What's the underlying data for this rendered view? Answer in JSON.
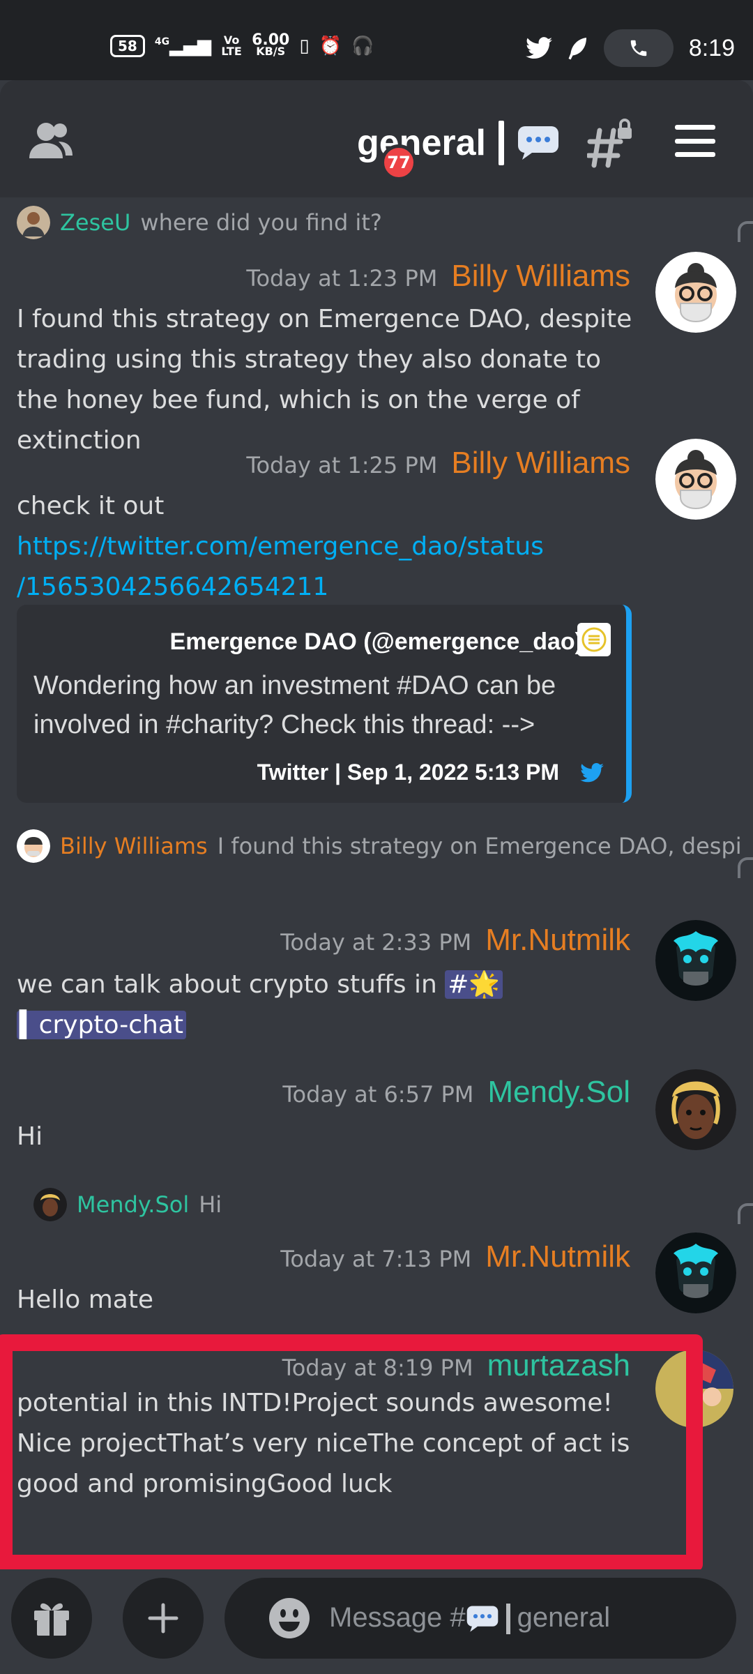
{
  "status_bar": {
    "battery": "58",
    "network_type": "4G",
    "volte": "Vo LTE",
    "speed_value": "6.00",
    "speed_unit": "KB/S",
    "time": "8:19",
    "icons": [
      "twitter-icon",
      "feather-icon",
      "phone-icon",
      "vibrate-icon",
      "alarm-icon",
      "headset-icon"
    ]
  },
  "header": {
    "channel_name": "general",
    "unread_badge": "77",
    "icons": [
      "members-icon",
      "speech-bubble-icon",
      "locked-thread-icon",
      "hamburger-menu-icon"
    ]
  },
  "messages": [
    {
      "reply_to": {
        "author": "ZeseU",
        "text": "where did you find it?"
      },
      "timestamp": "Today at 1:23 PM",
      "author": "Billy Williams",
      "text": "I found this strategy on Emergence DAO, despite trading using this strategy they also donate to the honey bee fund, which is on the verge of extinction"
    },
    {
      "timestamp": "Today at 1:25 PM",
      "author": "Billy Williams",
      "text": "check it out",
      "link": "https://twitter.com/emergence_dao/status/1565304256642654211",
      "link_line1": "https://twitter.com/emergence_dao/status",
      "link_line2": "/1565304256642654211",
      "embed": {
        "author": "Emergence DAO (@emergence_dao)",
        "text": "Wondering how an investment #DAO can be involved in #charity? Check this thread: -->",
        "footer": "Twitter | Sep 1, 2022 5:13 PM"
      }
    },
    {
      "reply_to": {
        "author": "Billy Williams",
        "text": "I found this strategy on Emergence DAO, despite trading using this strategy they also donate to the honey bee fund,"
      },
      "timestamp": "Today at 2:33 PM",
      "author": "Mr.Nutmilk",
      "text": "we can talk about crypto stuffs in ",
      "channel_mention_prefix": "#",
      "channel_mention_emoji": "🌟",
      "channel_mention_name": "▍crypto-chat"
    },
    {
      "timestamp": "Today at 6:57 PM",
      "author": "Mendy.Sol",
      "text": "Hi"
    },
    {
      "reply_to": {
        "author": "Mendy.Sol",
        "text": "Hi"
      },
      "timestamp": "Today at 7:13 PM",
      "author": "Mr.Nutmilk",
      "text": "Hello mate"
    },
    {
      "timestamp": "Today at 8:19 PM",
      "author": "murtazash",
      "text": "potential in this INTD!Project sounds awesome! Nice projectThat’s very niceThe concept of act is good and promisingGood luck"
    }
  ],
  "composer": {
    "placeholder_prefix": "Message #",
    "placeholder_channel": "general",
    "icons": [
      "gift-icon",
      "plus-icon",
      "emoji-icon",
      "speech-bubble-icon"
    ]
  },
  "colors": {
    "background": "#36393f",
    "header": "#2f3136",
    "orange_author": "#e67e22",
    "green_author": "#2ec4a0",
    "link": "#00aff4",
    "highlight": "#e8193c",
    "badge": "#ed4245"
  }
}
